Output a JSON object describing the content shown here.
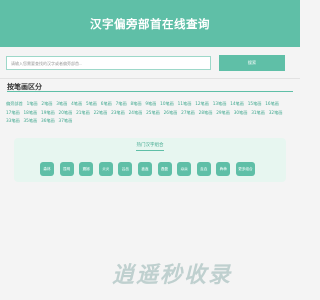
{
  "header": {
    "title": "汉字偏旁部首在线查询"
  },
  "search": {
    "placeholder": "请输入您需要查找的汉字或者偏旁部首...",
    "button_label": "搜索"
  },
  "strokes": {
    "title": "按笔画区分",
    "links": [
      "偏旁部首",
      "1笔画",
      "2笔画",
      "3笔画",
      "4笔画",
      "5笔画",
      "6笔画",
      "7笔画",
      "8笔画",
      "9笔画",
      "10笔画",
      "11笔画",
      "12笔画",
      "13笔画",
      "14笔画",
      "15笔画",
      "16笔画",
      "17笔画",
      "18笔画",
      "19笔画",
      "20笔画",
      "21笔画",
      "22笔画",
      "23笔画",
      "24笔画",
      "25笔画",
      "26笔画",
      "27笔画",
      "28笔画",
      "29笔画",
      "30笔画",
      "31笔画",
      "32笔画",
      "33笔画",
      "35笔画",
      "36笔画",
      "37笔画"
    ]
  },
  "hot": {
    "title": "热门汉字组合",
    "items": [
      "森林",
      "昆明",
      "震撼",
      "炎炎",
      "吕品",
      "鑫鑫",
      "磊磊",
      "焱焱",
      "垚垚",
      "犇犇",
      "更多组合"
    ]
  },
  "watermark": "逍遥秒收录",
  "colors": {
    "accent": "#5fbfa7",
    "link": "#3fa78e",
    "panel": "#e7f6f0"
  }
}
